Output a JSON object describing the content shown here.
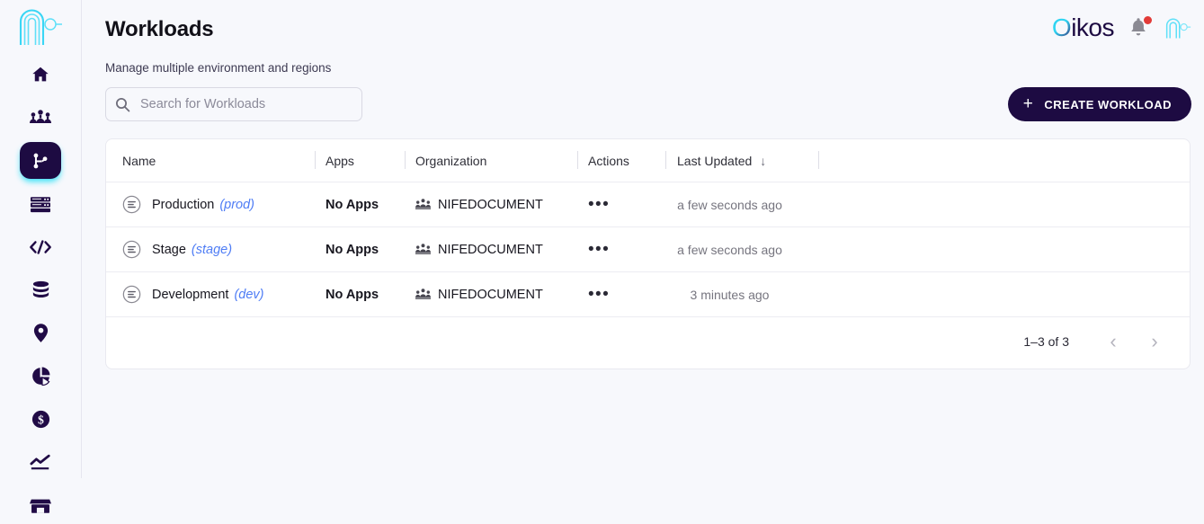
{
  "app": {
    "brand_prefix": "O",
    "brand_rest": "ikos",
    "accent_cyan": "#2fd4f2",
    "accent_dark": "#1d0b42",
    "env_tag_color": "#4f7df5"
  },
  "sidebar": {
    "logo_name": "oikos-logo",
    "items": [
      {
        "icon": "home-icon",
        "name": "sidebar-item-home",
        "active": false
      },
      {
        "icon": "people-icon",
        "name": "sidebar-item-teams",
        "active": false
      },
      {
        "icon": "git-branch-icon",
        "name": "sidebar-item-workloads",
        "active": true
      },
      {
        "icon": "server-icon",
        "name": "sidebar-item-servers",
        "active": false
      },
      {
        "icon": "code-icon",
        "name": "sidebar-item-code",
        "active": false
      },
      {
        "icon": "database-icon",
        "name": "sidebar-item-databases",
        "active": false
      },
      {
        "icon": "location-pin-icon",
        "name": "sidebar-item-regions",
        "active": false
      },
      {
        "icon": "pie-chart-icon",
        "name": "sidebar-item-analytics",
        "active": false
      },
      {
        "icon": "dollar-icon",
        "name": "sidebar-item-billing",
        "active": false
      },
      {
        "icon": "trending-up-icon",
        "name": "sidebar-item-metrics",
        "active": false
      },
      {
        "icon": "store-icon",
        "name": "sidebar-item-marketplace",
        "active": false
      }
    ]
  },
  "header": {
    "title": "Workloads",
    "subtitle": "Manage multiple environment and regions",
    "notification_badge": true
  },
  "search": {
    "placeholder": "Search for Workloads",
    "value": ""
  },
  "actions": {
    "create_label": "CREATE WORKLOAD",
    "create_plus": "+"
  },
  "table": {
    "columns": [
      {
        "label": "Name",
        "sorted": false
      },
      {
        "label": "Apps",
        "sorted": false
      },
      {
        "label": "Organization",
        "sorted": false
      },
      {
        "label": "Actions",
        "sorted": false
      },
      {
        "label": "Last Updated",
        "sorted": true,
        "sort_arrow": "↓"
      },
      {
        "label": "",
        "sorted": false
      }
    ],
    "rows": [
      {
        "name": "Production",
        "env": "(prod)",
        "apps": "No Apps",
        "organization": "NIFEDOCUMENT",
        "actions": "•••",
        "last_updated": "a few seconds ago"
      },
      {
        "name": "Stage",
        "env": "(stage)",
        "apps": "No Apps",
        "organization": "NIFEDOCUMENT",
        "actions": "•••",
        "last_updated": "a few seconds ago"
      },
      {
        "name": "Development",
        "env": "(dev)",
        "apps": "No Apps",
        "organization": "NIFEDOCUMENT",
        "actions": "•••",
        "last_updated": "3 minutes ago"
      }
    ],
    "pagination": {
      "range_label": "1–3 of 3",
      "prev_label": "‹",
      "next_label": "›"
    }
  }
}
